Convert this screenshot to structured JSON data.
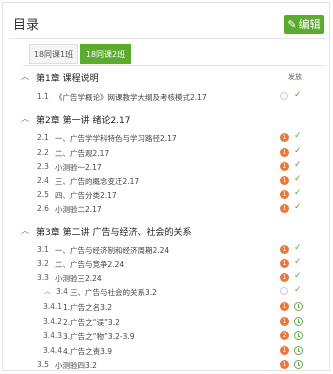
{
  "header": {
    "title": "目录",
    "edit_label": "编辑"
  },
  "tabs": [
    {
      "label": "18同课1班",
      "active": false
    },
    {
      "label": "18同课2班",
      "active": true
    }
  ],
  "columns": {
    "publish_label": "发放"
  },
  "chapters": [
    {
      "title": "第1章 课程说明",
      "items": [
        {
          "num": "1.1",
          "text": "《广告学概论》网课教学大纲及考核模式2.17",
          "status": "empty"
        }
      ]
    },
    {
      "title": "第2章 第一讲 绪论2.17",
      "items": [
        {
          "num": "2.1",
          "text": "一、广告学学科特色与学习路径2.17",
          "status": "badge",
          "badge": "1"
        },
        {
          "num": "2.2",
          "text": "二、广告观2.17",
          "status": "badge",
          "badge": "1"
        },
        {
          "num": "2.3",
          "text": "小测验一2.17",
          "status": "badge",
          "badge": "1"
        },
        {
          "num": "2.4",
          "text": "三、广告的概念变迁2.17",
          "status": "badge",
          "badge": "1"
        },
        {
          "num": "2.5",
          "text": "四、广告分类2.17",
          "status": "badge",
          "badge": "1"
        },
        {
          "num": "2.6",
          "text": "小测验二2.17",
          "status": "badge",
          "badge": "1"
        }
      ]
    },
    {
      "title": "第3章 第二讲 广告与经济、社会的关系",
      "items": [
        {
          "num": "3.1",
          "text": "一、广告与经济制和经济周期2.24",
          "status": "badge",
          "badge": "1"
        },
        {
          "num": "3.2",
          "text": "二、广告与竞争2.24",
          "status": "badge",
          "badge": "1"
        },
        {
          "num": "3.3",
          "text": "小测验三2.24",
          "status": "badge",
          "badge": "1"
        },
        {
          "num": "3.4",
          "text": "三、广告与社会的关系3.2",
          "status": "empty-subgroup"
        },
        {
          "num": "3.4.1",
          "text": "1.广告之名3.2",
          "status": "badge-clock",
          "badge": "1"
        },
        {
          "num": "3.4.2",
          "text": "2.广告之“误”3.2",
          "status": "badge-clock",
          "badge": "1"
        },
        {
          "num": "3.4.3",
          "text": "3.广告之“物”3.2-3.9",
          "status": "badge-clock",
          "badge": "2"
        },
        {
          "num": "3.4.4",
          "text": "4.广告之责3.9",
          "status": "badge-clock",
          "badge": "1"
        },
        {
          "num": "3.5",
          "text": "小测验四3.2",
          "status": "badge-clock",
          "badge": "1"
        }
      ]
    }
  ]
}
